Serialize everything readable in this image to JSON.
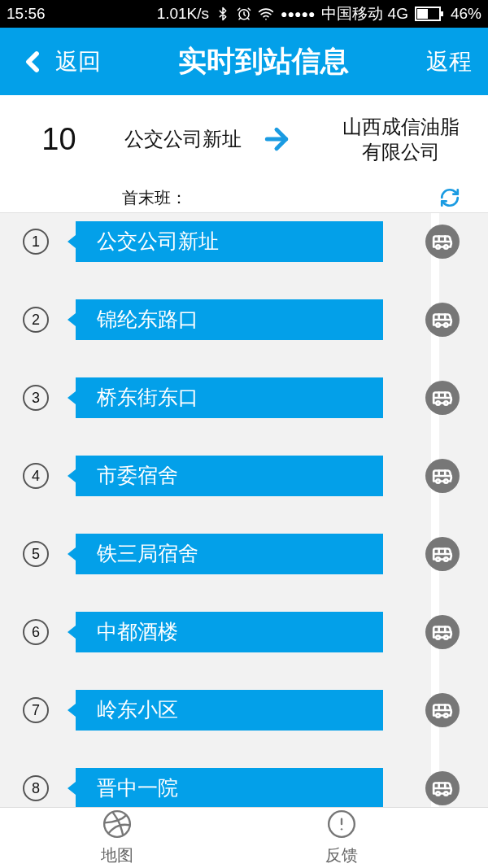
{
  "status_bar": {
    "time": "15:56",
    "speed": "1.01K/s",
    "signal": "●●●●●",
    "carrier": "中国移动 4G",
    "battery": "46%"
  },
  "header": {
    "back": "返回",
    "title": "实时到站信息",
    "right": "返程"
  },
  "route": {
    "number": "10",
    "from": "公交公司新址",
    "to": "山西成信油脂有限公司"
  },
  "schedule_label": "首末班：",
  "stops": [
    {
      "number": "1",
      "name": "公交公司新址"
    },
    {
      "number": "2",
      "name": "锦纶东路口"
    },
    {
      "number": "3",
      "name": "桥东街东口"
    },
    {
      "number": "4",
      "name": "市委宿舍"
    },
    {
      "number": "5",
      "name": "铁三局宿舍"
    },
    {
      "number": "6",
      "name": "中都酒楼"
    },
    {
      "number": "7",
      "name": "岭东小区"
    },
    {
      "number": "8",
      "name": "晋中一院"
    }
  ],
  "tab_bar": [
    {
      "kind": "map",
      "label": "地图"
    },
    {
      "kind": "feedback",
      "label": "反馈"
    }
  ]
}
